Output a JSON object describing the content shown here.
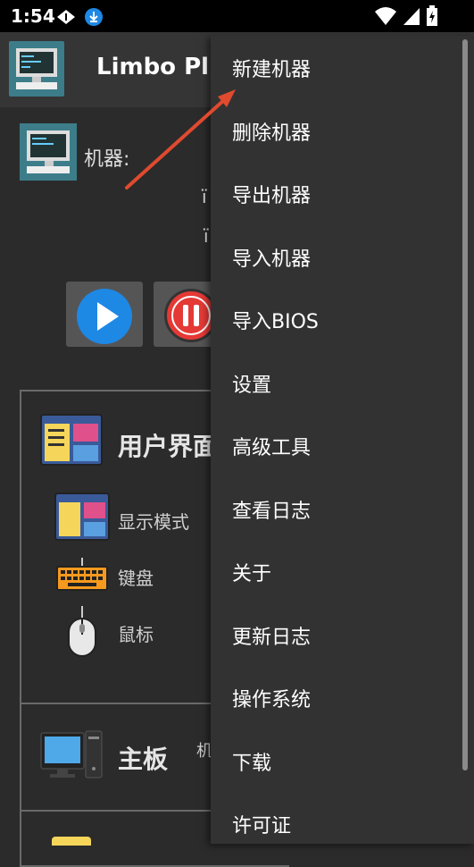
{
  "status_bar": {
    "time": "1:54"
  },
  "app_bar": {
    "title": "Limbo Plu"
  },
  "machine": {
    "label": "机器:",
    "fragments": [
      "ï",
      "ï"
    ]
  },
  "sections": {
    "ui": {
      "title": "用户界面",
      "items": [
        "显示模式",
        "键盘",
        "鼠标"
      ]
    },
    "board": {
      "title": "主板",
      "side_text": "机"
    }
  },
  "menu": {
    "items": [
      "新建机器",
      "删除机器",
      "导出机器",
      "导入机器",
      "导入BIOS",
      "设置",
      "高级工具",
      "查看日志",
      "关于",
      "更新日志",
      "操作系统",
      "下载",
      "许可证"
    ]
  },
  "colors": {
    "accent": "#1e88e5",
    "stop": "#e53935",
    "arrow": "#e04a2f"
  }
}
